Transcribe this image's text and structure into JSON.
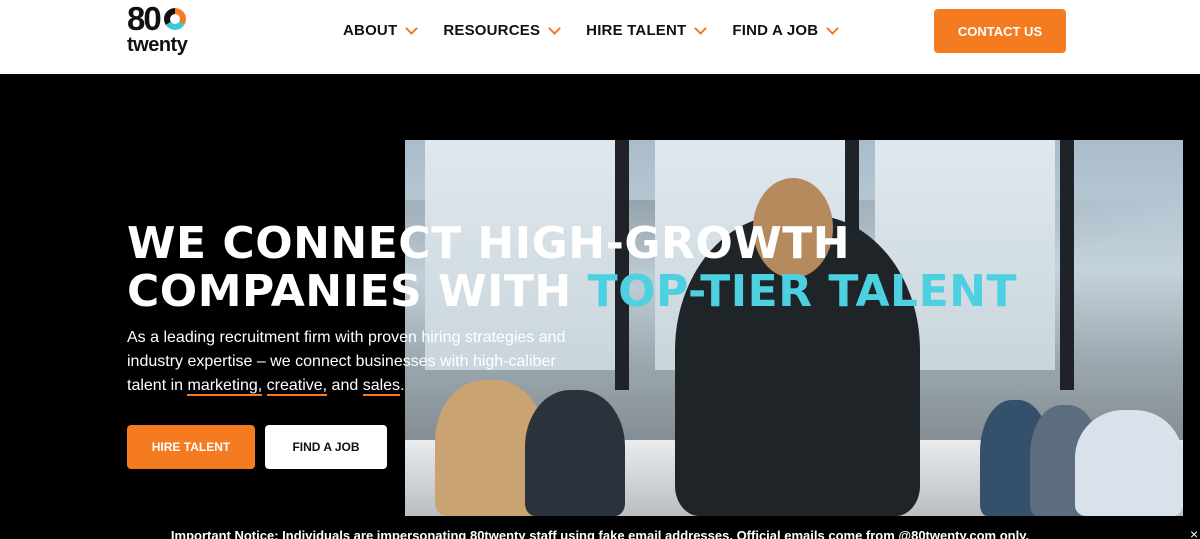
{
  "header": {
    "logo": {
      "number": "80",
      "word": "twenty"
    },
    "nav": [
      {
        "label": "ABOUT"
      },
      {
        "label": "RESOURCES"
      },
      {
        "label": "HIRE TALENT"
      },
      {
        "label": "FIND A JOB"
      }
    ],
    "contact_label": "CONTACT US"
  },
  "hero": {
    "headline_line1": "WE CONNECT HIGH-GROWTH",
    "headline_line2_prefix": "COMPANIES WITH ",
    "headline_accent": "TOP-TIER TALENT",
    "sub_text_1": "As a leading recruitment firm with proven hiring strategies and industry expertise – we connect businesses with high-caliber talent in ",
    "link_marketing": "marketing,",
    "link_creative": "creative,",
    "sub_and": " and ",
    "link_sales": "sales",
    "sub_end": ".",
    "hire_btn": "HIRE TALENT",
    "job_btn": "FIND A JOB"
  },
  "notice": {
    "text": "Important Notice: Individuals are impersonating 80twenty staff using fake email addresses. Official emails come from @80twenty.com only.",
    "close": "×"
  },
  "colors": {
    "accent": "#f47b20",
    "highlight": "#4dd0df",
    "background": "#000000"
  },
  "icons": [
    "chevron-down-icon",
    "close-icon"
  ]
}
